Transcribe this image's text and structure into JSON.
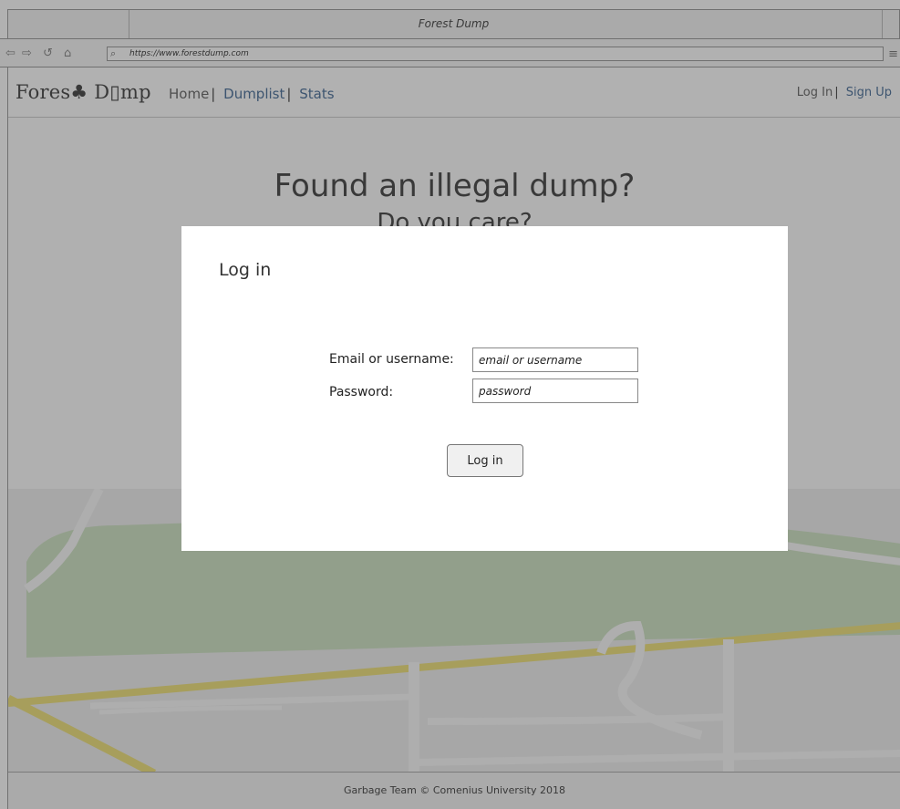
{
  "window": {
    "title": "Forest Dump"
  },
  "browser": {
    "url": "https://www.forestdump.com",
    "icons": [
      "back-arrow-icon",
      "forward-arrow-icon",
      "refresh-icon",
      "home-icon",
      "search-icon",
      "menu-icon"
    ]
  },
  "header": {
    "logo": "Fores♣ D▯mp",
    "nav": {
      "home": "Home",
      "dumplist": "Dumplist",
      "stats": "Stats"
    },
    "auth": {
      "login": "Log In",
      "signup": "Sign Up"
    }
  },
  "hero": {
    "title": "Found an illegal dump?",
    "subtitle": "Do you care?"
  },
  "modal": {
    "title": "Log in",
    "email_label": "Email or username:",
    "email_placeholder": "email or username",
    "password_label": "Password:",
    "password_placeholder": "password",
    "submit_label": "Log in"
  },
  "footer": {
    "text": "Garbage Team © Comenius University 2018"
  },
  "colors": {
    "link": "#4a6f9a",
    "map_green": "#cfe3c4",
    "map_road": "#f5f5f5",
    "map_highway": "#f0e27a",
    "overlay": "rgba(40,40,40,0.36)"
  }
}
